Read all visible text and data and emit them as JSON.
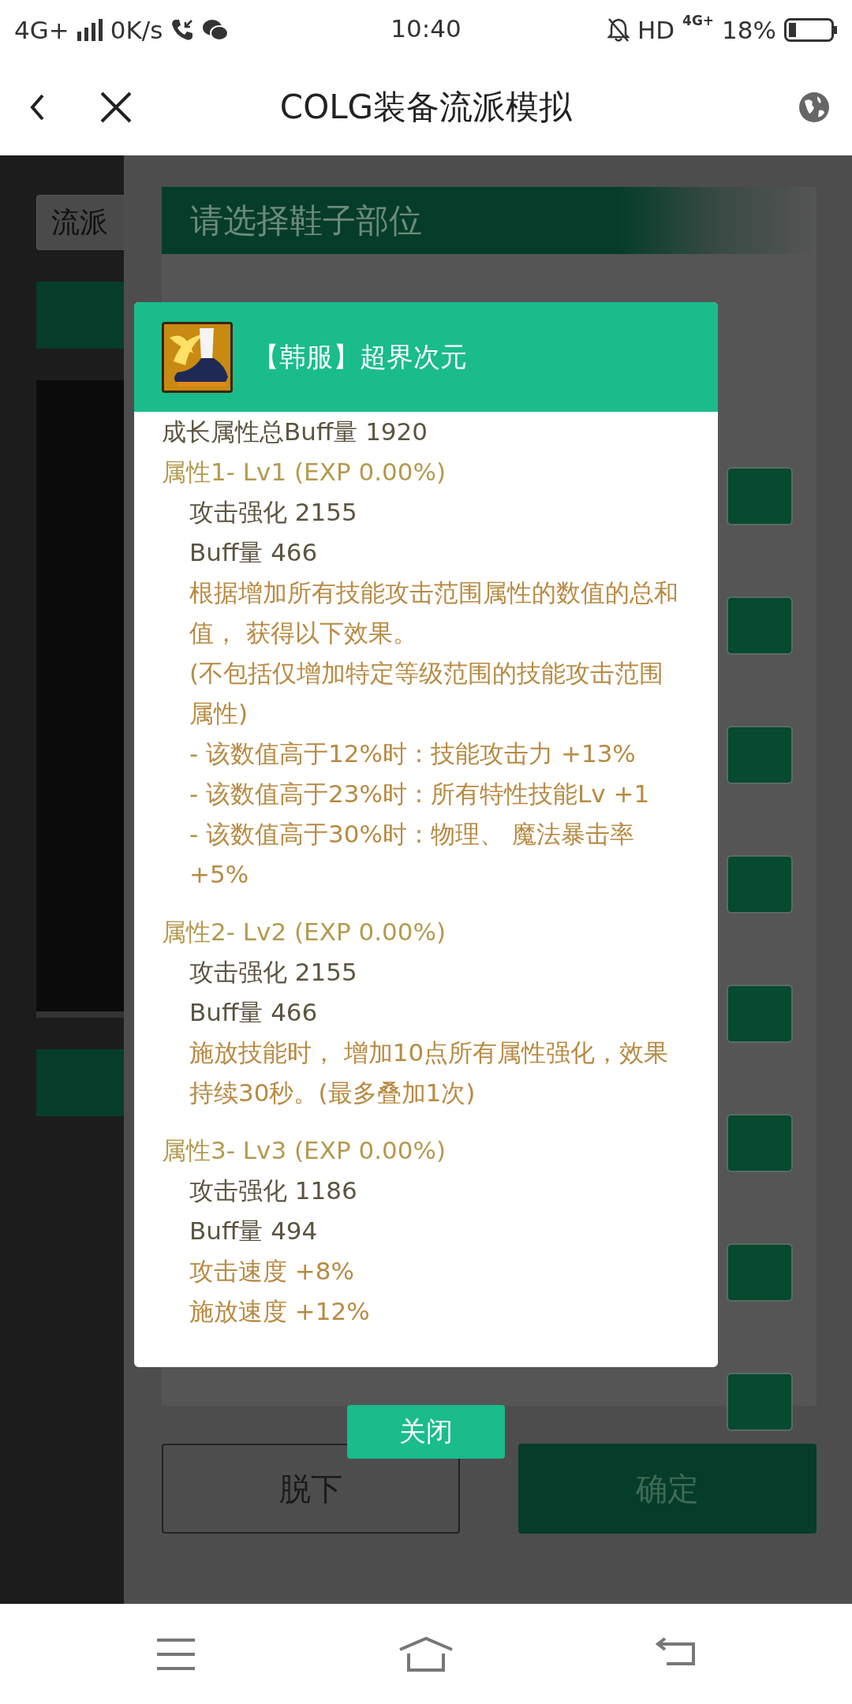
{
  "status_bar": {
    "network": "4G+",
    "speed": "0K/s",
    "time": "10:40",
    "hd": "HD",
    "network_right": "4G+",
    "battery": "18%"
  },
  "app_bar": {
    "title": "COLG装备流派模拟"
  },
  "background": {
    "left_field": "流派",
    "panel_title": "请选择鞋子部位",
    "buttons": [
      {
        "label": "脱下",
        "kind": "outline"
      },
      {
        "label": "确定",
        "kind": "primary"
      }
    ]
  },
  "modal": {
    "item_name": "【韩服】超界次元",
    "total": "成长属性总Buff量 1920",
    "attributes": [
      {
        "heading": "属性1- Lv1 (EXP 0.00%)",
        "lines": [
          {
            "kind": "stat",
            "text": "攻击强化 2155"
          },
          {
            "kind": "stat",
            "text": "Buff量 466"
          },
          {
            "kind": "effect",
            "text": "根据增加所有技能攻击范围属性的数值的总和值， 获得以下效果。"
          },
          {
            "kind": "effect",
            "text": "(不包括仅增加特定等级范围的技能攻击范围属性)"
          },
          {
            "kind": "effect",
            "text": "- 该数值高于12%时 : 技能攻击力 +13%"
          },
          {
            "kind": "effect",
            "text": "- 该数值高于23%时 : 所有特性技能Lv +1"
          },
          {
            "kind": "effect",
            "text": "- 该数值高于30%时 : 物理、 魔法暴击率 +5%"
          }
        ]
      },
      {
        "heading": "属性2- Lv2 (EXP 0.00%)",
        "lines": [
          {
            "kind": "stat",
            "text": "攻击强化 2155"
          },
          {
            "kind": "stat",
            "text": "Buff量 466"
          },
          {
            "kind": "effect",
            "text": "施放技能时， 增加10点所有属性强化，效果持续30秒。(最多叠加1次)"
          }
        ]
      },
      {
        "heading": "属性3- Lv3 (EXP 0.00%)",
        "lines": [
          {
            "kind": "stat",
            "text": "攻击强化 1186"
          },
          {
            "kind": "stat",
            "text": "Buff量 494"
          },
          {
            "kind": "effect",
            "text": "攻击速度 +8%"
          },
          {
            "kind": "effect",
            "text": "施放速度 +12%"
          }
        ]
      }
    ],
    "close": "关闭"
  }
}
